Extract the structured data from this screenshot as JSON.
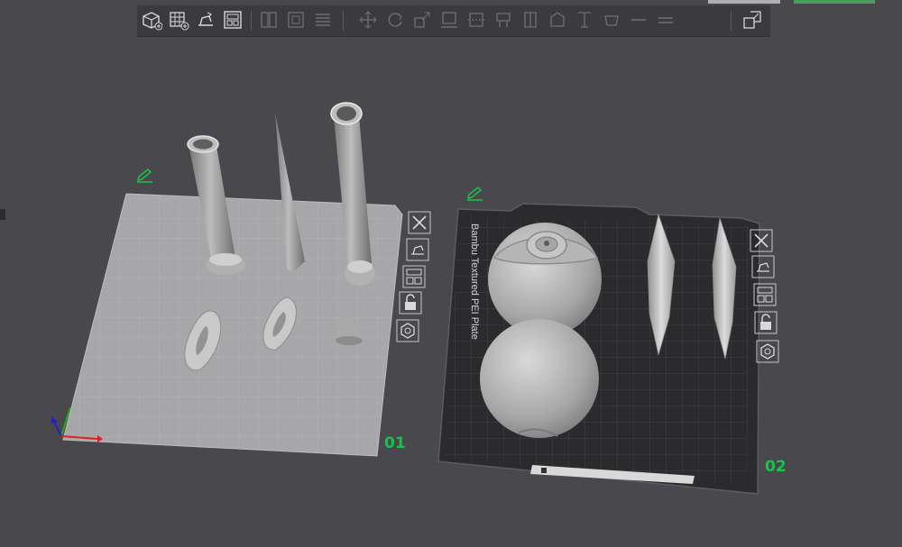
{
  "toolbar": {
    "buttons": [
      {
        "name": "add-object-icon"
      },
      {
        "name": "add-plate-icon"
      },
      {
        "name": "auto-orient-icon"
      },
      {
        "name": "arrange-icon"
      },
      {
        "name": "split-objects-icon"
      },
      {
        "name": "split-parts-icon"
      },
      {
        "name": "layers-icon"
      },
      {
        "name": "move-icon"
      },
      {
        "name": "rotate-icon"
      },
      {
        "name": "scale-icon"
      },
      {
        "name": "lay-on-face-icon"
      },
      {
        "name": "cut-icon"
      },
      {
        "name": "support-paint-icon"
      },
      {
        "name": "seam-paint-icon"
      },
      {
        "name": "color-paint-icon"
      },
      {
        "name": "measure-icon"
      },
      {
        "name": "text-icon"
      },
      {
        "name": "assembly-icon"
      },
      {
        "name": "variable-layer-icon"
      },
      {
        "name": "view-icon"
      }
    ]
  },
  "plates": [
    {
      "number": "01",
      "label": ""
    },
    {
      "number": "02",
      "label": "Bambu Textured PEI Plate"
    }
  ],
  "colors": {
    "accent": "#16c44b",
    "background": "#48484d",
    "plate_light": "#a7a7aa",
    "plate_dark": "#2b2b2e",
    "model": "#b9b9b9"
  }
}
